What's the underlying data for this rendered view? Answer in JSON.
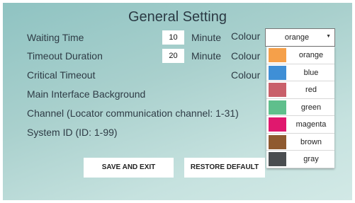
{
  "title": "General Setting",
  "rows": {
    "waiting_time": {
      "label": "Waiting Time",
      "value": "10",
      "unit": "Minute",
      "colour_label": "Colour"
    },
    "timeout_duration": {
      "label": "Timeout Duration",
      "value": "20",
      "unit": "Minute",
      "colour_label": "Colour"
    },
    "critical_timeout": {
      "label": "Critical Timeout",
      "colour_label": "Colour"
    },
    "main_interface_background": {
      "label": "Main Interface Background"
    },
    "channel": {
      "label": "Channel (Locator communication channel: 1-31)"
    },
    "system_id": {
      "label": "System ID (ID: 1-99)"
    }
  },
  "colour_select": {
    "selected": "orange",
    "options": [
      {
        "label": "orange",
        "color": "#f5a04a"
      },
      {
        "label": "blue",
        "color": "#3f8fd6"
      },
      {
        "label": "red",
        "color": "#c9606a"
      },
      {
        "label": "green",
        "color": "#5fbf8c"
      },
      {
        "label": "magenta",
        "color": "#e0186e"
      },
      {
        "label": "brown",
        "color": "#8f5a30"
      },
      {
        "label": "gray",
        "color": "#4a4d50"
      }
    ]
  },
  "buttons": {
    "save": "SAVE AND EXIT",
    "restore": "RESTORE DEFAULT"
  }
}
